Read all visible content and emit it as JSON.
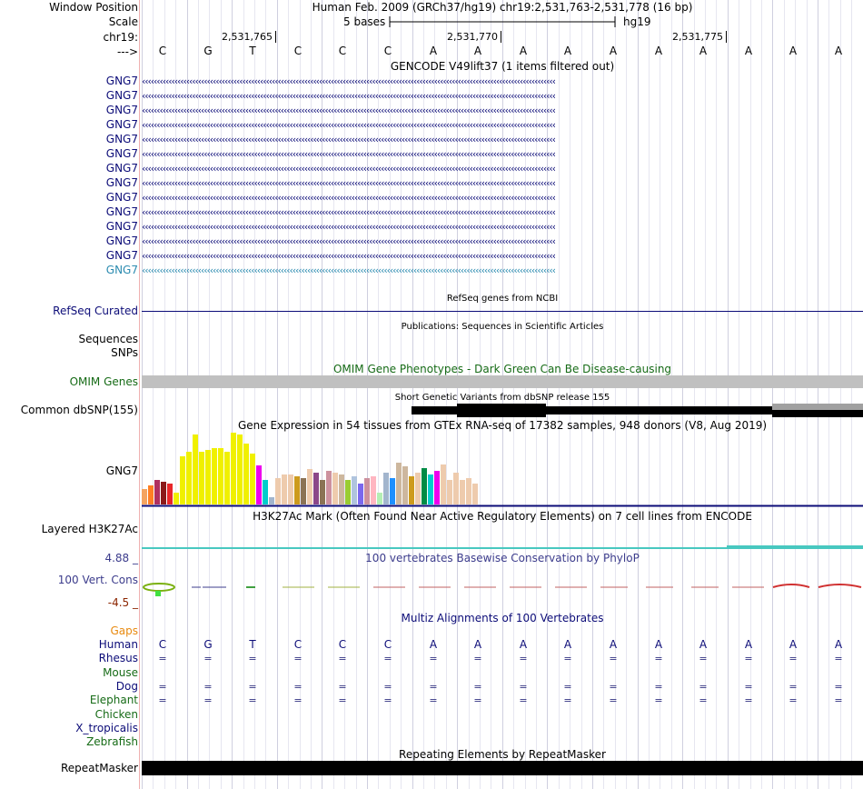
{
  "ruler": {
    "window_label": "Window Position",
    "window_text": "Human Feb. 2009 (GRCh37/hg19)   chr19:2,531,763-2,531,778 (16 bp)",
    "scale_label": "Scale",
    "scale_text": "5 bases",
    "scale_assembly": "hg19",
    "chrom_label": "chr19:",
    "positions": [
      "2,531,765",
      "2,531,770",
      "2,531,775"
    ],
    "strand_label": "--->",
    "bases": [
      "C",
      "G",
      "T",
      "C",
      "C",
      "C",
      "A",
      "A",
      "A",
      "A",
      "A",
      "A",
      "A",
      "A",
      "A",
      "A"
    ]
  },
  "gencode": {
    "title": "GENCODE V49lift37 (1 items filtered out)",
    "rows": [
      "GNG7",
      "GNG7",
      "GNG7",
      "GNG7",
      "GNG7",
      "GNG7",
      "GNG7",
      "GNG7",
      "GNG7",
      "GNG7",
      "GNG7",
      "GNG7",
      "GNG7",
      "GNG7"
    ],
    "color": "#0c0c78",
    "highlight_color": "#2b8bb0"
  },
  "refseq": {
    "title": "RefSeq genes from NCBI",
    "label": "RefSeq Curated",
    "color": "#0c0c78"
  },
  "publications": {
    "title": "Publications: Sequences in Scientific Articles",
    "sequences_label": "Sequences",
    "snps_label": "SNPs"
  },
  "omim": {
    "title": "OMIM Gene Phenotypes - Dark Green Can Be Disease-causing",
    "label": "OMIM Genes",
    "color": "#166b16",
    "bar_color": "#c0c0c0"
  },
  "dbsnp": {
    "title": "Short Genetic Variants from dbSNP release 155",
    "label": "Common dbSNP(155)"
  },
  "gtex": {
    "title": "Gene Expression in 54 tissues from GTEx RNA-seq of 17382 samples, 948 donors (V8, Aug 2019)",
    "label": "GNG7",
    "chart_data": {
      "type": "bar",
      "values": [
        18,
        22,
        28,
        26,
        24,
        14,
        55,
        60,
        80,
        60,
        62,
        64,
        64,
        60,
        82,
        80,
        70,
        58,
        45,
        28,
        8,
        30,
        34,
        34,
        32,
        30,
        40,
        36,
        28,
        38,
        36,
        34,
        28,
        32,
        24,
        30,
        32,
        14,
        36,
        30,
        48,
        44,
        32,
        36,
        42,
        34,
        38,
        46,
        28,
        36,
        28,
        30,
        24
      ],
      "colors": [
        "#f4a460",
        "#ff7f24",
        "#b03060",
        "#8b1a1a",
        "#e8262a",
        "#f0f000",
        "#f0f000",
        "#f0f000",
        "#f0f000",
        "#f0f000",
        "#f0f000",
        "#f0f000",
        "#f0f000",
        "#f0f000",
        "#f0f000",
        "#f0f000",
        "#f0f000",
        "#f0f000",
        "#ee00ee",
        "#00cdcd",
        "#a2b5cd",
        "#eecbad",
        "#eecbad",
        "#eecbad",
        "#cd9b1d",
        "#8b7355",
        "#eecbad",
        "#8b4789",
        "#8b7355",
        "#cd919e",
        "#eecbad",
        "#cdb79e",
        "#9acd32",
        "#b0c4de",
        "#7b68ee",
        "#cd919e",
        "#ffb6c1",
        "#b4eeb4",
        "#a2b5cd",
        "#1e90ff",
        "#cdb79e",
        "#cdb79e",
        "#cd9b1d",
        "#eecbad",
        "#008b45",
        "#00cdcd",
        "#ee00ee",
        "#eecbad",
        "#eecbad",
        "#eecbad",
        "#eecbad",
        "#eecbad",
        "#eecbad"
      ]
    }
  },
  "h3k27ac": {
    "title": "H3K27Ac Mark (Often Found Near Active Regulatory Elements) on 7 cell lines from ENCODE",
    "label": "Layered H3K27Ac"
  },
  "phylop": {
    "title": "100 vertebrates Basewise Conservation by PhyloP",
    "label": "100 Vert. Cons",
    "max_label": "4.88 _",
    "min_label": "-4.5 _",
    "max_color": "#3c3c8c",
    "min_color": "#8b2500"
  },
  "multiz": {
    "title": "Multiz Alignments of 100 Vertebrates",
    "gaps_label": "Gaps",
    "species": [
      "Human",
      "Rhesus",
      "Mouse",
      "Dog",
      "Elephant",
      "Chicken",
      "X_tropicalis",
      "Zebrafish"
    ],
    "species_colors": [
      "#0c0c78",
      "#0c0c78",
      "#166b16",
      "#0c0c78",
      "#166b16",
      "#166b16",
      "#0c0c78",
      "#166b16"
    ],
    "eq_rows": [
      1,
      3,
      4
    ],
    "eq_symbol": "="
  },
  "repeatmasker": {
    "title": "Repeating Elements by RepeatMasker",
    "label": "RepeatMasker"
  }
}
